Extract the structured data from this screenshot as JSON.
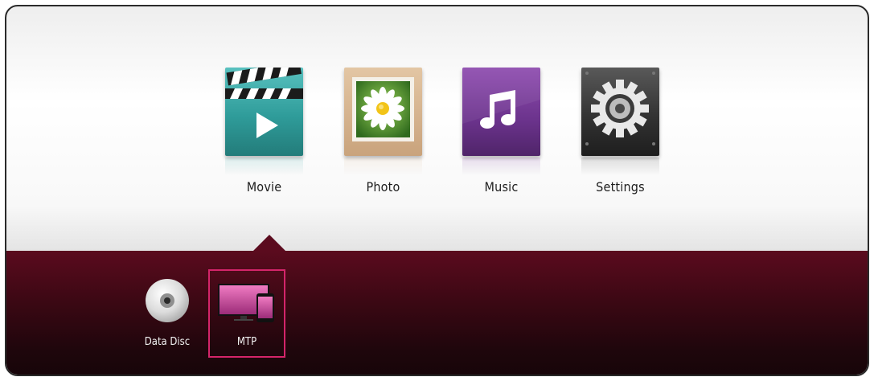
{
  "main_menu": {
    "items": [
      {
        "label": "Movie",
        "icon": "clapperboard-play-icon",
        "color": "#3aa8a6"
      },
      {
        "label": "Photo",
        "icon": "daisy-photo-icon",
        "color": "#d9b48e"
      },
      {
        "label": "Music",
        "icon": "music-note-icon",
        "color": "#7a3a9e"
      },
      {
        "label": "Settings",
        "icon": "gear-icon",
        "color": "#3a3a3a"
      }
    ],
    "selected": "Movie"
  },
  "device_bar": {
    "items": [
      {
        "label": "Data Disc",
        "icon": "disc-icon"
      },
      {
        "label": "MTP",
        "icon": "monitor-phone-icon"
      }
    ],
    "selected": "MTP",
    "highlight_color": "#d4256a",
    "background_color": "#4a0a18"
  }
}
